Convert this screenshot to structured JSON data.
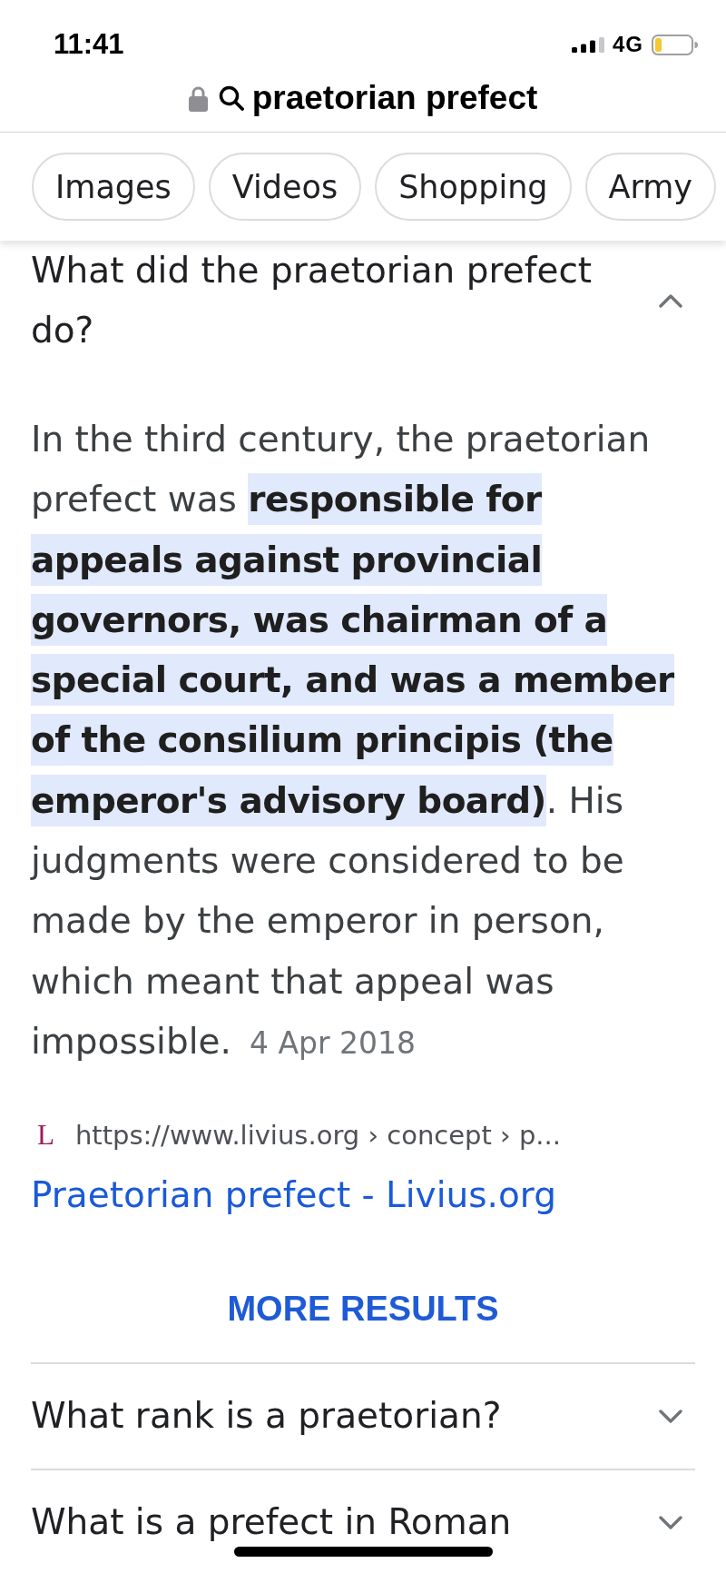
{
  "status_bar": {
    "time": "11:41",
    "network": "4G"
  },
  "address_bar": {
    "query": "praetorian prefect"
  },
  "chips": [
    {
      "label": "Images"
    },
    {
      "label": "Videos"
    },
    {
      "label": "Shopping"
    },
    {
      "label": "Army"
    }
  ],
  "questions": [
    {
      "question": "What did the praetorian prefect do?",
      "expanded": true,
      "answer": {
        "text": "In the third century, the praetorian prefect was **responsible for appeals against provincial governors, was chairman of a special court, and was a member of the consilium principis (the emperor's advisory board)**. His judgments were considered to be made by the emperor in person, which meant that appeal was impossible.",
        "date": "4 Apr 2018"
      },
      "source": {
        "favicon": "L",
        "url": "https://www.livius.org › concept › p...",
        "title": "Praetorian prefect - Livius.org"
      },
      "more_results": "MORE RESULTS"
    },
    {
      "question": "What rank is a praetorian?",
      "expanded": false
    },
    {
      "question": "What is a prefect in Roman",
      "expanded": false
    }
  ]
}
